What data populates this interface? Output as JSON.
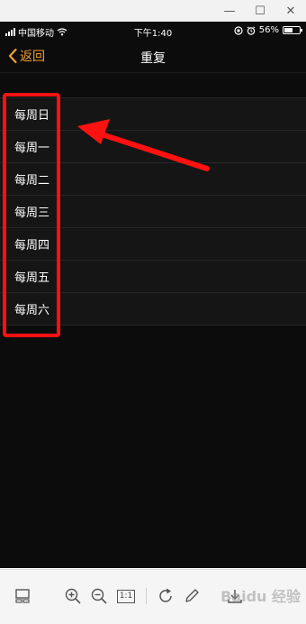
{
  "window": {
    "minimize_glyph": "—",
    "maximize_glyph": "☐",
    "close_glyph": "✕"
  },
  "status_bar": {
    "carrier": "中国移动",
    "time": "下午1:40",
    "battery": "56%",
    "battery_level": 0.56
  },
  "nav": {
    "back_label": "返回",
    "title": "重复"
  },
  "days": [
    {
      "label": "每周日"
    },
    {
      "label": "每周一"
    },
    {
      "label": "每周二"
    },
    {
      "label": "每周三"
    },
    {
      "label": "每周四"
    },
    {
      "label": "每周五"
    },
    {
      "label": "每周六"
    }
  ],
  "toolbar": {
    "actual_size_label": "1:1",
    "icons": [
      "thumbnail-icon",
      "zoom-in-icon",
      "zoom-out-icon",
      "actual-size-icon",
      "rotate-icon",
      "edit-icon",
      "download-icon"
    ],
    "watermark": "Baidu 经验"
  },
  "colors": {
    "accent": "#f0a030",
    "annotation": "#ff1111",
    "screen_bg": "#0c0c0c"
  }
}
